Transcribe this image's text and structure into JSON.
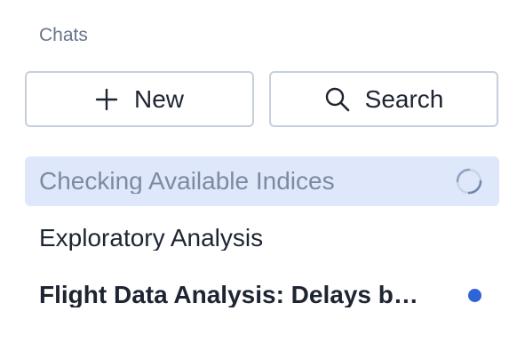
{
  "sidebar": {
    "section_title": "Chats",
    "new_button_label": "New",
    "search_button_label": "Search",
    "chats": [
      {
        "label": "Checking Available Indices",
        "status": "loading",
        "active": true
      },
      {
        "label": "Exploratory Analysis",
        "status": "none",
        "active": false
      },
      {
        "label": "Flight Data Analysis: Delays by ...",
        "status": "unread",
        "active": false
      }
    ]
  },
  "icons": {
    "new": "plus-icon",
    "search": "magnifier-icon",
    "loading": "spinner-icon",
    "unread": "unread-dot-icon"
  },
  "colors": {
    "active_bg": "#dfe8fa",
    "accent": "#2f63d8",
    "muted_text": "#69758a",
    "text": "#1e2532",
    "border": "#c7cfdb"
  }
}
